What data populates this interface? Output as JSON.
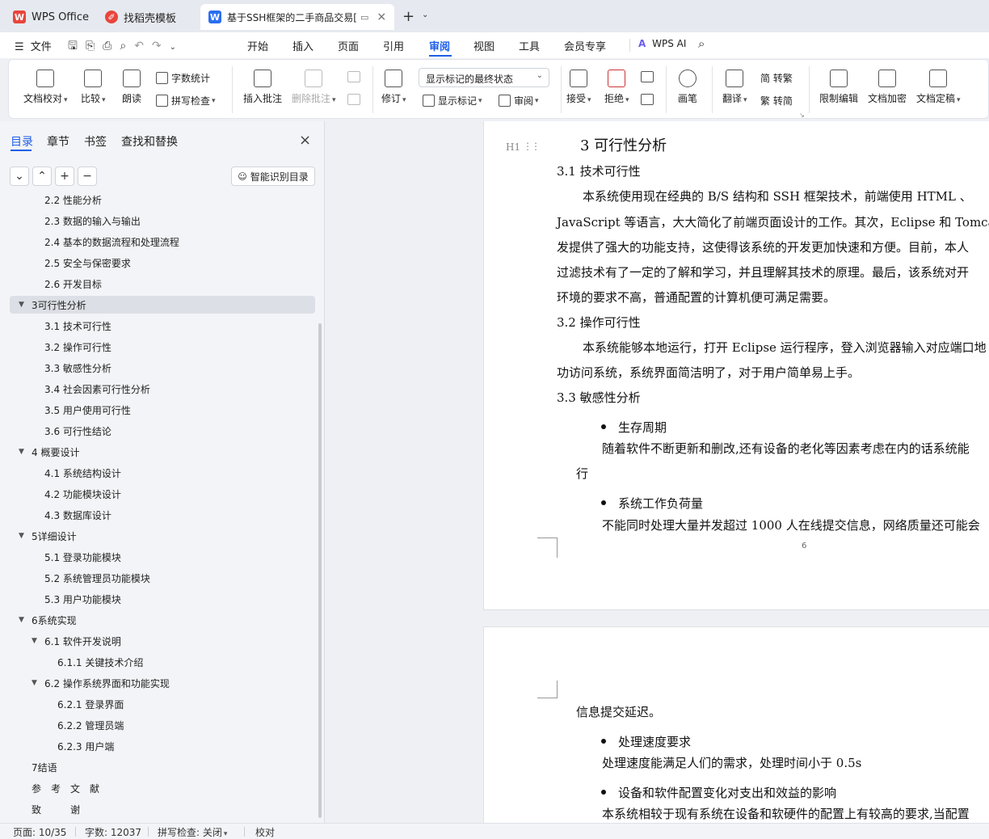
{
  "tabs": [
    {
      "label": "WPS Office",
      "icon": "wps-logo-icon"
    },
    {
      "label": "找稻壳模板",
      "icon": "docer-icon"
    },
    {
      "label": "基于SSH框架的二手商品交易[",
      "icon": "wps-writer-icon",
      "active": true
    }
  ],
  "menu": {
    "file": "文件",
    "items": [
      "开始",
      "插入",
      "页面",
      "引用",
      "审阅",
      "视图",
      "工具",
      "会员专享"
    ],
    "active": "审阅",
    "ai": "WPS AI"
  },
  "ribbon": {
    "proofread": "文档校对",
    "compare": "比较",
    "read_aloud": "朗读",
    "word_count": "字数统计",
    "spell_check": "拼写检查",
    "insert_comment": "插入批注",
    "delete_comment": "删除批注",
    "track_changes": "修订",
    "markup_state": "显示标记的最终状态",
    "show_markup": "显示标记",
    "review_pane": "审阅",
    "accept": "接受",
    "reject": "拒绝",
    "pen": "画笔",
    "translate": "翻译",
    "to_traditional": "简 转繁",
    "to_simplified": "繁 转简",
    "restrict_edit": "限制编辑",
    "encrypt": "文档加密",
    "finalize": "文档定稿"
  },
  "nav": {
    "tabs": [
      "目录",
      "章节",
      "书签",
      "查找和替换"
    ],
    "smart_toc": "智能识别目录",
    "items": [
      {
        "label": "2.2 性能分析",
        "level": 2
      },
      {
        "label": "2.3  数据的输入与输出",
        "level": 2
      },
      {
        "label": "2.4  基本的数据流程和处理流程",
        "level": 2
      },
      {
        "label": "2.5  安全与保密要求",
        "level": 2
      },
      {
        "label": "2.6  开发目标",
        "level": 2
      },
      {
        "label": "3可行性分析",
        "level": 1,
        "expanded": true,
        "selected": true
      },
      {
        "label": "3.1 技术可行性",
        "level": 2
      },
      {
        "label": "3.2 操作可行性",
        "level": 2
      },
      {
        "label": "3.3 敏感性分析",
        "level": 2
      },
      {
        "label": "3.4 社会因素可行性分析",
        "level": 2
      },
      {
        "label": "3.5 用户使用可行性",
        "level": 2
      },
      {
        "label": "3.6 可行性结论",
        "level": 2
      },
      {
        "label": "4 概要设计",
        "level": 1,
        "expanded": true
      },
      {
        "label": "4.1 系统结构设计",
        "level": 2
      },
      {
        "label": "4.2 功能模块设计",
        "level": 2
      },
      {
        "label": "4.3 数据库设计",
        "level": 2
      },
      {
        "label": "5详细设计",
        "level": 1,
        "expanded": true
      },
      {
        "label": "5.1 登录功能模块",
        "level": 2
      },
      {
        "label": "5.2 系统管理员功能模块",
        "level": 2
      },
      {
        "label": "5.3    用户功能模块",
        "level": 2
      },
      {
        "label": "6系统实现",
        "level": 1,
        "expanded": true
      },
      {
        "label": "6.1    软件开发说明",
        "level": 2,
        "expanded": true
      },
      {
        "label": "6.1.1    关键技术介绍",
        "level": 3
      },
      {
        "label": "6.2    操作系统界面和功能实现",
        "level": 2,
        "expanded": true
      },
      {
        "label": "6.2.1    登录界面",
        "level": 3
      },
      {
        "label": "6.2.2    管理员端",
        "level": 3
      },
      {
        "label": "6.2.3    用户端",
        "level": 3
      },
      {
        "label": "7结语",
        "level": 1
      },
      {
        "label": "参　考　文　献",
        "level": 1
      },
      {
        "label": "致　　　谢",
        "level": 1
      }
    ]
  },
  "doc": {
    "heading_marker": "H1",
    "h1": "3   可行性分析",
    "s31": "3.1 技术可行性",
    "p1_l1": "本系统使用现在经典的 B/S 结构和 SSH 框架技术，前端使用 HTML 、",
    "p1_l2": "JavaScript 等语言，大大简化了前端页面设计的工作。其次，Eclipse 和 Tomcat",
    "p1_l3": "发提供了强大的功能支持，这使得该系统的开发更加快速和方便。目前，本人",
    "p1_l4": "过滤技术有了一定的了解和学习，并且理解其技术的原理。最后，该系统对开",
    "p1_l5": "环境的要求不高，普通配置的计算机便可满足需要。",
    "s32": "3.2 操作可行性",
    "p2_l1": "本系统能够本地运行，打开 Eclipse 运行程序，登入浏览器输入对应端口地",
    "p2_l2": "功访问系统，系统界面简洁明了，对于用户简单易上手。",
    "s33": "3.3 敏感性分析",
    "b1": "生存周期",
    "b1_l1": "随着软件不断更新和删改,还有设备的老化等因素考虑在内的话系统能",
    "b1_l2": "行",
    "b2": "系统工作负荷量",
    "b2_l1": "不能同时处理大量并发超过 1000 人在线提交信息，网络质量还可能会",
    "page_number": "6",
    "p7_l1": "信息提交延迟。",
    "b3": "处理速度要求",
    "b3_l1": "处理速度能满足人们的需求，处理时间小于 0.5s",
    "b4": "设备和软件配置变化对支出和效益的影响",
    "b4_l1": "本系统相较于现有系统在设备和软硬件的配置上有较高的要求,当配置"
  },
  "status": {
    "page": "页面: 10/35",
    "words": "字数: 12037",
    "spell": "拼写检查: 关闭",
    "proof": "校对"
  },
  "colors": {
    "accent": "#1e5ee8",
    "wps_red": "#e8453c"
  }
}
